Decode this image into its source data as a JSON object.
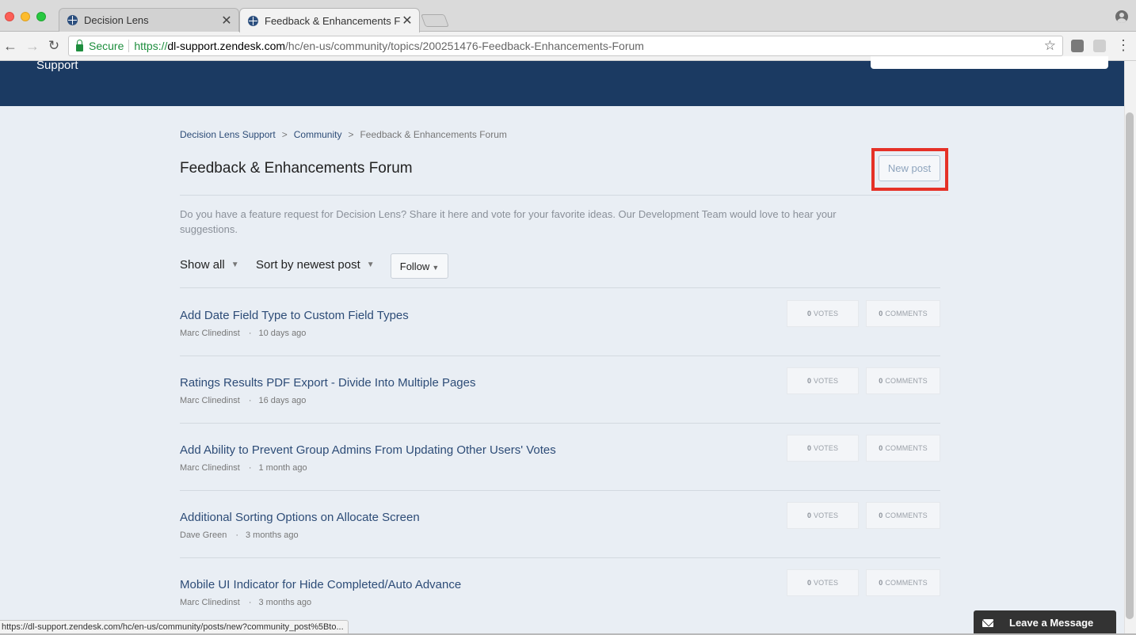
{
  "browser": {
    "tabs": [
      {
        "title": "Decision Lens",
        "close": "✕"
      },
      {
        "title": "Feedback & Enhancements Fo",
        "close": "✕"
      }
    ],
    "address": {
      "secure_label": "Secure",
      "scheme": "https://",
      "host": "dl-support.zendesk.com",
      "path": "/hc/en-us/community/topics/200251476-Feedback-Enhancements-Forum"
    },
    "icons": {
      "back": "←",
      "forward": "→",
      "reload": "↻",
      "star": "☆",
      "menu": "⋮"
    },
    "status_url": "https://dl-support.zendesk.com/hc/en-us/community/posts/new?community_post%5Bto..."
  },
  "header": {
    "brand_sub": "Support"
  },
  "breadcrumb": [
    {
      "label": "Decision Lens Support"
    },
    {
      "label": "Community"
    },
    {
      "label": "Feedback & Enhancements Forum"
    }
  ],
  "breadcrumb_sep": ">",
  "page": {
    "title": "Feedback & Enhancements Forum",
    "new_post_label": "New post",
    "description": "Do you have a feature request for Decision Lens? Share it here and vote for your favorite ideas. Our Development Team would love to hear your suggestions."
  },
  "filters": {
    "show": "Show all",
    "sort": "Sort by newest post",
    "follow": "Follow",
    "caret": "▼"
  },
  "posts": [
    {
      "title": "Add Date Field Type to Custom Field Types",
      "author": "Marc Clinedinst",
      "time": "10 days ago",
      "votes": "0",
      "comments": "0"
    },
    {
      "title": "Ratings Results PDF Export - Divide Into Multiple Pages",
      "author": "Marc Clinedinst",
      "time": "16 days ago",
      "votes": "0",
      "comments": "0"
    },
    {
      "title": "Add Ability to Prevent Group Admins From Updating Other Users' Votes",
      "author": "Marc Clinedinst",
      "time": "1 month ago",
      "votes": "0",
      "comments": "0"
    },
    {
      "title": "Additional Sorting Options on Allocate Screen",
      "author": "Dave Green",
      "time": "3 months ago",
      "votes": "0",
      "comments": "0"
    },
    {
      "title": "Mobile UI Indicator for Hide Completed/Auto Advance",
      "author": "Marc Clinedinst",
      "time": "3 months ago",
      "votes": "0",
      "comments": "0"
    }
  ],
  "labels": {
    "votes": "VOTES",
    "comments": "COMMENTS",
    "meta_dot": "·"
  },
  "chat": {
    "label": "Leave a Message"
  },
  "colors": {
    "header_bg": "#1b3a62",
    "link": "#2d4c77",
    "highlight": "#e53127",
    "page_bg": "#e9eef4"
  }
}
